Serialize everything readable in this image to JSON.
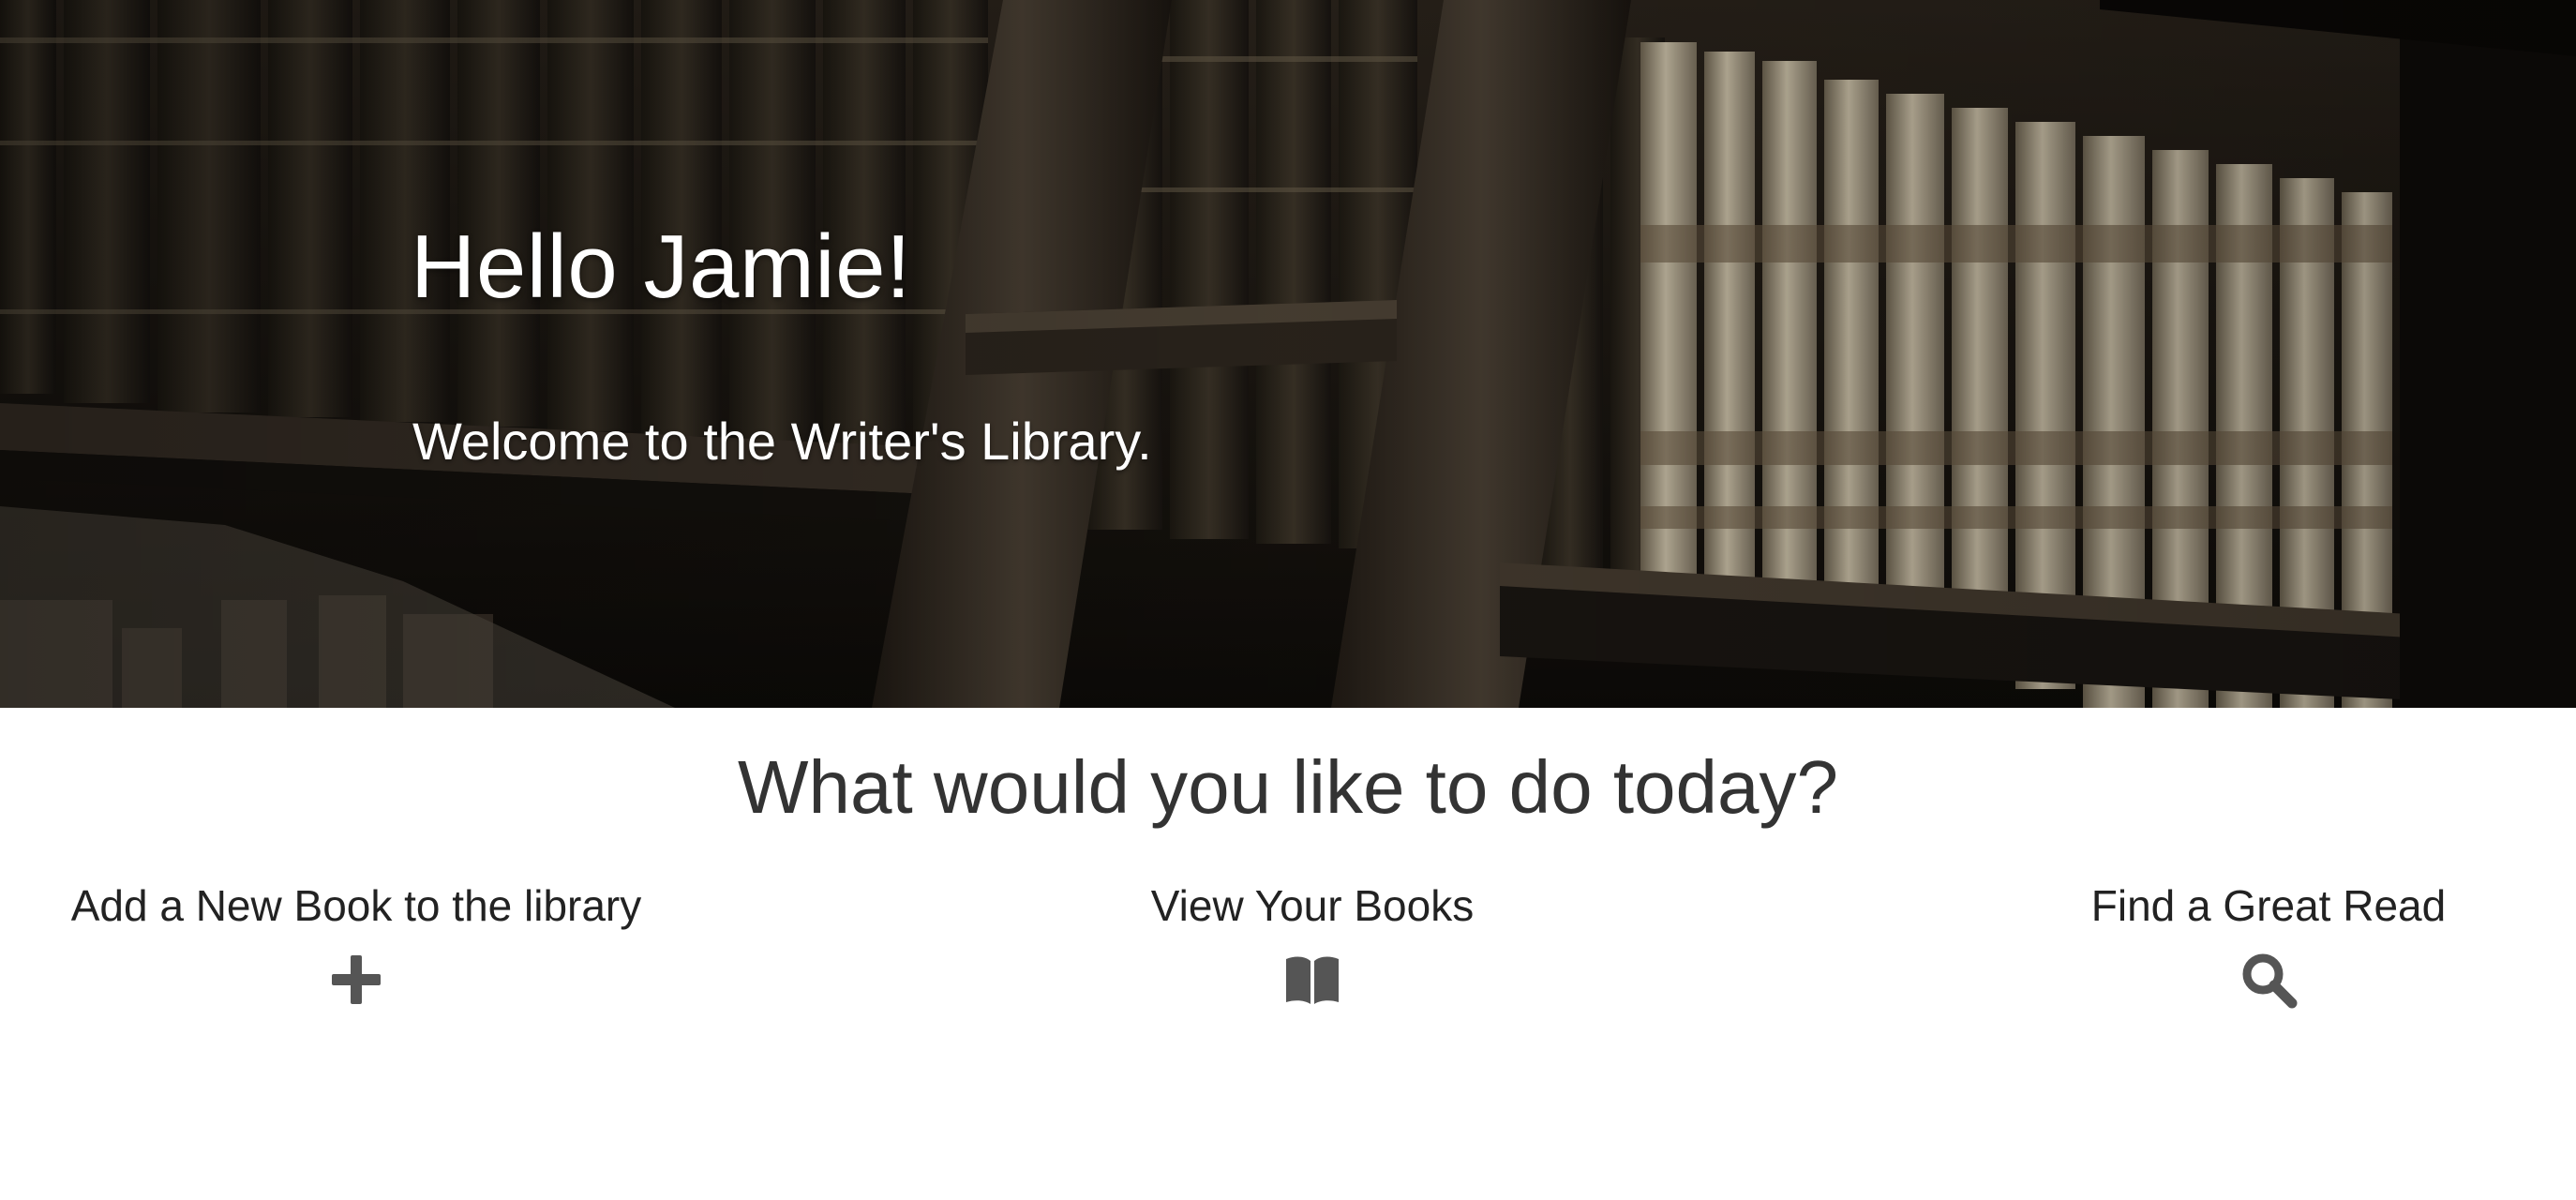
{
  "hero": {
    "greeting": "Hello Jamie!",
    "subtitle": "Welcome to the Writer's Library."
  },
  "main": {
    "prompt": "What would you like to do today?",
    "actions": [
      {
        "label": "Add a New Book to the library",
        "icon": "plus-icon"
      },
      {
        "label": "View Your Books",
        "icon": "open-book-icon"
      },
      {
        "label": "Find a Great Read",
        "icon": "search-icon"
      }
    ]
  },
  "colors": {
    "hero_overlay": "#1b1610",
    "heading_text": "#333333",
    "icon": "#555555"
  }
}
